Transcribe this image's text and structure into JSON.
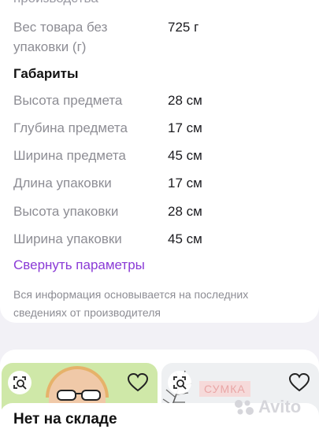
{
  "specs": {
    "cut_off_text": "производства",
    "weight_label_line1": "Вес товара без",
    "weight_label_line2": "упаковки (г)",
    "weight_value": "725 г",
    "section_title": "Габариты",
    "rows": [
      {
        "label": "Высота предмета",
        "value": "28 см"
      },
      {
        "label": "Глубина предмета",
        "value": "17 см"
      },
      {
        "label": "Ширина предмета",
        "value": "45 см"
      },
      {
        "label": "Длина упаковки",
        "value": "17 см"
      },
      {
        "label": "Высота упаковки",
        "value": "28 см"
      },
      {
        "label": "Ширина упаковки",
        "value": "45 см"
      }
    ],
    "collapse_link": "Свернуть параметры",
    "disclaimer": "Вся информация основывается на последних сведениях от производителя"
  },
  "recommendations": {
    "right_tile_label": "СУМКА",
    "stock_banner": "Нет на складе",
    "watermark": "Avito"
  },
  "colors": {
    "accent": "#8a3ad6",
    "left_tile_bg": "#cfe8a8",
    "page_bg": "#f2f1f6"
  }
}
